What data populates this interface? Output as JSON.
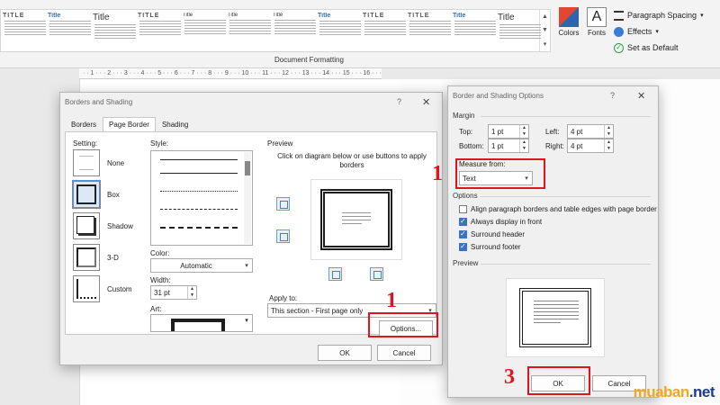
{
  "ribbon": {
    "styles_gallery": [
      {
        "title": "TITLE",
        "style": "caps"
      },
      {
        "title": "Title",
        "style": "blue"
      },
      {
        "title": "Title",
        "style": "big"
      },
      {
        "title": "TITLE",
        "style": "caps"
      },
      {
        "title": "Title",
        "style": "small"
      },
      {
        "title": "Title",
        "style": "small"
      },
      {
        "title": "Title",
        "style": "small"
      },
      {
        "title": "Title",
        "style": "blue"
      },
      {
        "title": "TITLE",
        "style": "caps"
      },
      {
        "title": "TITLE",
        "style": "caps"
      },
      {
        "title": "Title",
        "style": "blue"
      },
      {
        "title": "Title",
        "style": "big"
      }
    ],
    "group_label": "Document Formatting",
    "colors_label": "Colors",
    "fonts_label": "Fonts",
    "paragraph_spacing": "Paragraph Spacing",
    "effects": "Effects",
    "set_as_default": "Set as Default",
    "fonts_icon": "A"
  },
  "ruler": {
    "text": "· · 1 · · · 2 · · · 3 · · · 4 · · · 5 · · · 6 · · · 7 · · · 8 · · · 9 · · · 10 · · · 11 · · · 12 · · · 13 · · · 14 · · · 15 · · · 16 · · ·"
  },
  "borders_dialog": {
    "title": "Borders and Shading",
    "help": "?",
    "close": "✕",
    "tabs": [
      "Borders",
      "Page Border",
      "Shading"
    ],
    "active_tab": "Page Border",
    "setting_label": "Setting:",
    "settings": [
      "None",
      "Box",
      "Shadow",
      "3-D",
      "Custom"
    ],
    "selected_setting": "Box",
    "style_label": "Style:",
    "color_label": "Color:",
    "color_value": "Automatic",
    "width_label": "Width:",
    "width_value": "31 pt",
    "art_label": "Art:",
    "preview_label": "Preview",
    "preview_hint": "Click on diagram below or use buttons to apply borders",
    "apply_to_label": "Apply to:",
    "apply_to_value": "This section - First page only",
    "options_button": "Options...",
    "ok_button": "OK",
    "cancel_button": "Cancel"
  },
  "options_dialog": {
    "title": "Border and Shading Options",
    "help": "?",
    "close": "✕",
    "margin_label": "Margin",
    "top_label": "Top:",
    "top_value": "1 pt",
    "left_label": "Left:",
    "left_value": "4 pt",
    "bottom_label": "Bottom:",
    "bottom_value": "1 pt",
    "right_label": "Right:",
    "right_value": "4 pt",
    "measure_from_label": "Measure from:",
    "measure_from_value": "Text",
    "options_label": "Options",
    "checkboxes": [
      {
        "label": "Align paragraph borders and table edges with page border",
        "checked": false
      },
      {
        "label": "Always display in front",
        "checked": true
      },
      {
        "label": "Surround header",
        "checked": true
      },
      {
        "label": "Surround footer",
        "checked": true
      }
    ],
    "preview_label": "Preview",
    "ok_button": "OK",
    "cancel_button": "Cancel"
  },
  "annotations": {
    "measure_step": "1",
    "options_step": "1",
    "ok_step": "3",
    "color": "#e0141e"
  },
  "watermark": {
    "brand": "muaban",
    "tld": ".net",
    "brand_color": "#f5a623",
    "tld_color": "#1d3c8f"
  }
}
